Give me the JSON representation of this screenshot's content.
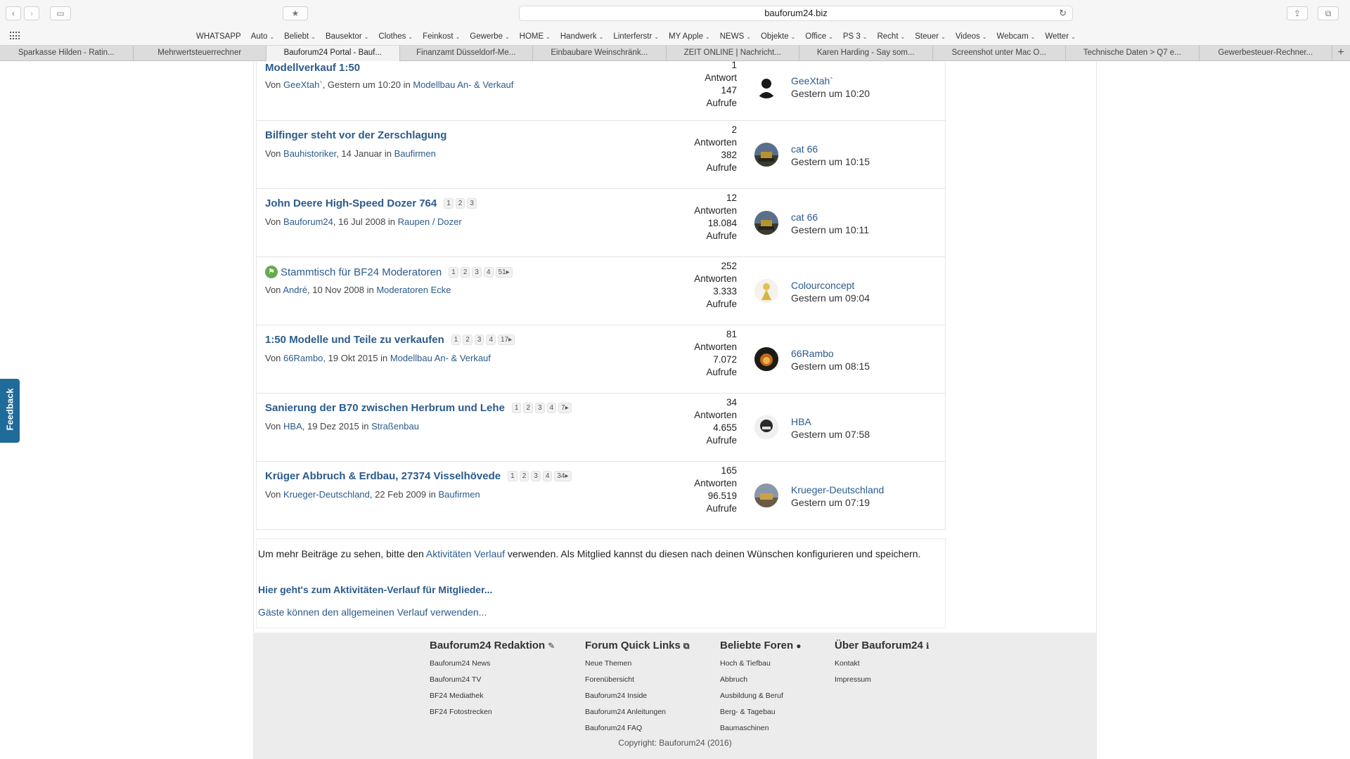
{
  "browser": {
    "url": "bauforum24.biz",
    "bookmarks": [
      {
        "label": "WHATSAPP",
        "menu": false
      },
      {
        "label": "Auto",
        "menu": true
      },
      {
        "label": "Beliebt",
        "menu": true
      },
      {
        "label": "Bausektor",
        "menu": true
      },
      {
        "label": "Clothes",
        "menu": true
      },
      {
        "label": "Feinkost",
        "menu": true
      },
      {
        "label": "Gewerbe",
        "menu": true
      },
      {
        "label": "HOME",
        "menu": true
      },
      {
        "label": "Handwerk",
        "menu": true
      },
      {
        "label": "Linterferstr",
        "menu": true
      },
      {
        "label": "MY Apple",
        "menu": true
      },
      {
        "label": "NEWS",
        "menu": true
      },
      {
        "label": "Objekte",
        "menu": true
      },
      {
        "label": "Office",
        "menu": true
      },
      {
        "label": "PS 3",
        "menu": true
      },
      {
        "label": "Recht",
        "menu": true
      },
      {
        "label": "Steuer",
        "menu": true
      },
      {
        "label": "Videos",
        "menu": true
      },
      {
        "label": "Webcam",
        "menu": true
      },
      {
        "label": "Wetter",
        "menu": true
      }
    ],
    "tabs": [
      {
        "label": "Sparkasse Hilden - Ratin...",
        "active": false
      },
      {
        "label": "Mehrwertsteuerrechner",
        "active": false
      },
      {
        "label": "Bauforum24 Portal - Bauf...",
        "active": true
      },
      {
        "label": "Finanzamt Düsseldorf-Me...",
        "active": false
      },
      {
        "label": "Einbaubare Weinschränk...",
        "active": false
      },
      {
        "label": "ZEIT ONLINE | Nachricht...",
        "active": false
      },
      {
        "label": "Karen Harding - Say som...",
        "active": false
      },
      {
        "label": "Screenshot unter Mac O...",
        "active": false
      },
      {
        "label": "Technische Daten > Q7 e...",
        "active": false
      },
      {
        "label": "Gewerbesteuer-Rechner...",
        "active": false
      }
    ]
  },
  "threads": [
    {
      "title": "Modellverkauf 1:50",
      "sticky": false,
      "pages": [],
      "by_prefix": "Von ",
      "author": "GeeXtah`",
      "date": ", Gestern um 10:20 in ",
      "forum": [
        "Modellbau An- & Verkauf"
      ],
      "replies": "1",
      "replies_label": "Antwort",
      "views": "147",
      "views_label": "Aufrufe",
      "last_user": "GeeXtah`",
      "last_time": "Gestern um 10:20",
      "avatar": "default-user-icon"
    },
    {
      "title": "Bilfinger steht vor der Zerschlagung",
      "sticky": false,
      "pages": [],
      "by_prefix": "Von ",
      "author": "Bauhistoriker",
      "date": ", 14 Januar in ",
      "forum": [
        "Baufirmen"
      ],
      "replies": "2",
      "replies_label": "Antworten",
      "views": "382",
      "views_label": "Aufrufe",
      "last_user": "cat 66",
      "last_time": "Gestern um 10:15",
      "avatar": "excavator-photo"
    },
    {
      "title": "John Deere High-Speed Dozer 764",
      "sticky": false,
      "pages": [
        "1",
        "2",
        "3"
      ],
      "by_prefix": "Von ",
      "author": "Bauforum24",
      "date": ", 16 Jul 2008 in ",
      "forum": [
        "Raupen",
        "Dozer"
      ],
      "replies": "12",
      "replies_label": "Antworten",
      "views": "18.084",
      "views_label": "Aufrufe",
      "last_user": "cat 66",
      "last_time": "Gestern um 10:11",
      "avatar": "excavator-photo"
    },
    {
      "title": "Stammtisch für BF24 Moderatoren",
      "sticky": true,
      "pages": [
        "1",
        "2",
        "3",
        "4",
        "51▸"
      ],
      "by_prefix": "Von ",
      "author": "André",
      "date": ", 10 Nov 2008 in ",
      "forum": [
        "Moderatoren Ecke"
      ],
      "replies": "252",
      "replies_label": "Antworten",
      "views": "3.333",
      "views_label": "Aufrufe",
      "last_user": "Colourconcept",
      "last_time": "Gestern um 09:04",
      "avatar": "figure-photo"
    },
    {
      "title": "1:50 Modelle und Teile zu verkaufen",
      "sticky": false,
      "pages": [
        "1",
        "2",
        "3",
        "4",
        "17▸"
      ],
      "by_prefix": "Von ",
      "author": "66Rambo",
      "date": ", 19 Okt 2015 in ",
      "forum": [
        "Modellbau An- & Verkauf"
      ],
      "replies": "81",
      "replies_label": "Antworten",
      "views": "7.072",
      "views_label": "Aufrufe",
      "last_user": "66Rambo",
      "last_time": "Gestern um 08:15",
      "avatar": "fire-photo"
    },
    {
      "title": "Sanierung der B70 zwischen Herbrum und Lehe",
      "sticky": false,
      "pages": [
        "1",
        "2",
        "3",
        "4",
        "7▸"
      ],
      "by_prefix": "Von ",
      "author": "HBA",
      "date": ", 19 Dez 2015 in ",
      "forum": [
        "Straßenbau"
      ],
      "replies": "34",
      "replies_label": "Antworten",
      "views": "4.655",
      "views_label": "Aufrufe",
      "last_user": "HBA",
      "last_time": "Gestern um 07:58",
      "avatar": "face-photo"
    },
    {
      "title": "Krüger Abbruch & Erdbau, 27374 Visselhövede",
      "sticky": false,
      "pages": [
        "1",
        "2",
        "3",
        "4",
        "34▸"
      ],
      "by_prefix": "Von ",
      "author": "Krueger-Deutschland",
      "date": ", 22 Feb 2009 in ",
      "forum": [
        "Baufirmen"
      ],
      "replies": "165",
      "replies_label": "Antworten",
      "views": "96.519",
      "views_label": "Aufrufe",
      "last_user": "Krueger-Deutschland",
      "last_time": "Gestern um 07:19",
      "avatar": "machine-photo"
    }
  ],
  "info": {
    "text_before": "Um mehr Beiträge zu sehen, bitte den ",
    "text_link": "Aktivitäten Verlauf",
    "text_after": " verwenden. Als Mitglied kannst du diesen nach deinen Wünschen konfigurieren und speichern.",
    "member_link": "Hier geht's zum Aktivitäten-Verlauf für Mitglieder...",
    "guest_link": "Gäste können den allgemeinen Verlauf verwenden..."
  },
  "footer": {
    "columns": [
      {
        "title": "Bauforum24 Redaktion",
        "icon": "✎",
        "icon_name": "pencil-icon",
        "links": [
          "Bauforum24 News",
          "Bauforum24 TV",
          "BF24 Mediathek",
          "BF24 Fotostrecken"
        ]
      },
      {
        "title": "Forum Quick Links",
        "icon": "⧉",
        "icon_name": "external-link-icon",
        "links": [
          "Neue Themen",
          "Forenübersicht",
          "Bauforum24 Inside",
          "Bauforum24 Anleitungen",
          "Bauforum24 FAQ"
        ]
      },
      {
        "title": "Beliebte Foren",
        "icon": "●",
        "icon_name": "comment-icon",
        "links": [
          "Hoch & Tiefbau",
          "Abbruch",
          "Ausbildung & Beruf",
          "Berg- & Tagebau",
          "Baumaschinen"
        ]
      },
      {
        "title": "Über Bauforum24",
        "icon": "ℹ",
        "icon_name": "info-icon",
        "links": [
          "Kontakt",
          "Impressum"
        ]
      }
    ],
    "copyright": "Copyright: Bauforum24 (2016)"
  },
  "feedback": {
    "label": "Feedback",
    "color": "#1f6b9a"
  }
}
